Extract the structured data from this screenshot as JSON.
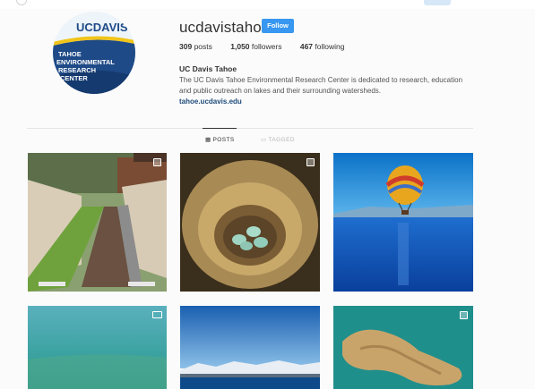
{
  "profile": {
    "username": "ucdavistahoe",
    "follow_label": "Follow",
    "stats": {
      "posts_count": "309",
      "posts_label": "posts",
      "followers_count": "1,050",
      "followers_label": "followers",
      "following_count": "467",
      "following_label": "following"
    },
    "full_name": "UC Davis Tahoe",
    "bio_line1": "The UC Davis Tahoe Environmental Research Center is dedicated to research, education",
    "bio_line2": "and public outreach on lakes and their surrounding watersheds.",
    "website": "tahoe.ucdavis.edu",
    "avatar": {
      "logo_top": "UCDAVIS",
      "logo_lines": [
        "TAHOE",
        "ENVIRONMENTAL",
        "RESEARCH",
        "CENTER"
      ]
    }
  },
  "tabs": [
    {
      "label": "POSTS",
      "icon": "grid-icon",
      "active": true
    },
    {
      "label": "TAGGED",
      "icon": "tag-icon",
      "active": false
    }
  ],
  "colors": {
    "accent": "#3897f0",
    "link": "#1e4b7a",
    "text": "#262626"
  },
  "posts": [
    {
      "name": "garden-beds",
      "badge": "multi-photo-icon"
    },
    {
      "name": "bird-nest-eggs",
      "badge": "multi-photo-icon"
    },
    {
      "name": "hot-air-balloon-lake",
      "badge": "none"
    },
    {
      "name": "underwater-green",
      "badge": "video-icon"
    },
    {
      "name": "snowy-mountains-lake",
      "badge": "none"
    },
    {
      "name": "aerial-algae",
      "badge": "multi-photo-icon"
    }
  ]
}
